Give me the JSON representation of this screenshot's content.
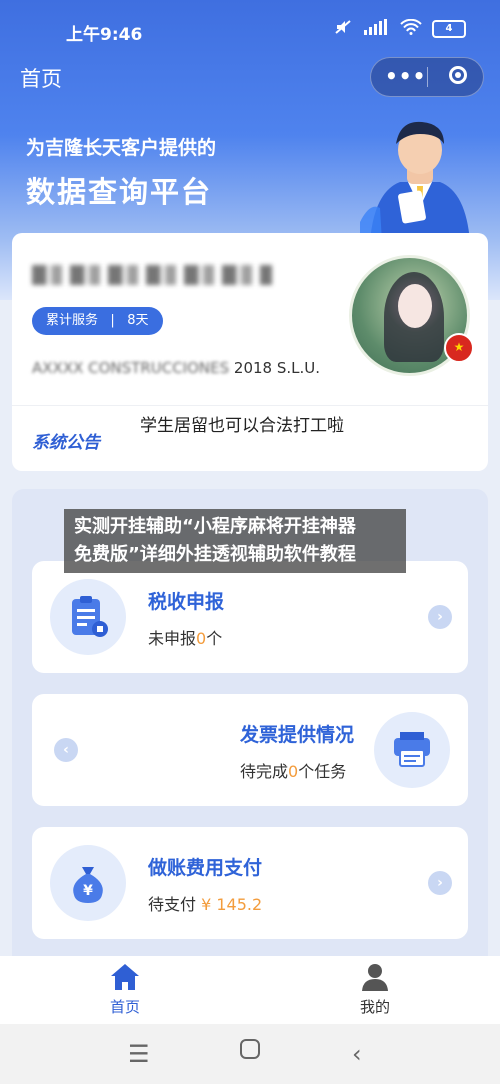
{
  "status_bar": {
    "time": "上午9:46",
    "battery": "4",
    "icons": [
      "mute-icon",
      "signal-icon",
      "wifi-icon",
      "battery-icon"
    ]
  },
  "nav": {
    "title": "首页",
    "menu_icon": "more-icon",
    "close_icon": "target-icon"
  },
  "banner": {
    "line1": "为吉隆长天客户提供的",
    "line2": "数据查询平台"
  },
  "profile": {
    "service_label": "累计服务",
    "service_days": "8天",
    "company": "2018 S.L.U.",
    "company_blurred_prefix": "AXXXX CONSTRUCCIONES",
    "notice_label": "系统公告",
    "notice_text": "学生居留也可以合法打工啦"
  },
  "overlay": {
    "line1": "实测开挂辅助“小程序麻将开挂神器",
    "line2": "免费版”详细外挂透视辅助软件教程"
  },
  "items": [
    {
      "title": "税收申报",
      "sub_prefix": "未申报",
      "value": "0",
      "sub_suffix": "个",
      "icon": "tax-report-icon"
    },
    {
      "title": "发票提供情况",
      "sub_prefix": "待完成",
      "value": "0",
      "sub_suffix": "个任务",
      "icon": "printer-icon"
    },
    {
      "title": "做账费用支付",
      "sub_prefix": "待支付",
      "value": "¥ 145.2",
      "sub_suffix": "",
      "icon": "money-bag-icon"
    }
  ],
  "tabs": [
    {
      "label": "首页",
      "icon": "home-icon"
    },
    {
      "label": "我的",
      "icon": "user-icon"
    }
  ],
  "colors": {
    "primary": "#3a6ee0",
    "accent_orange": "#f39c3c"
  }
}
